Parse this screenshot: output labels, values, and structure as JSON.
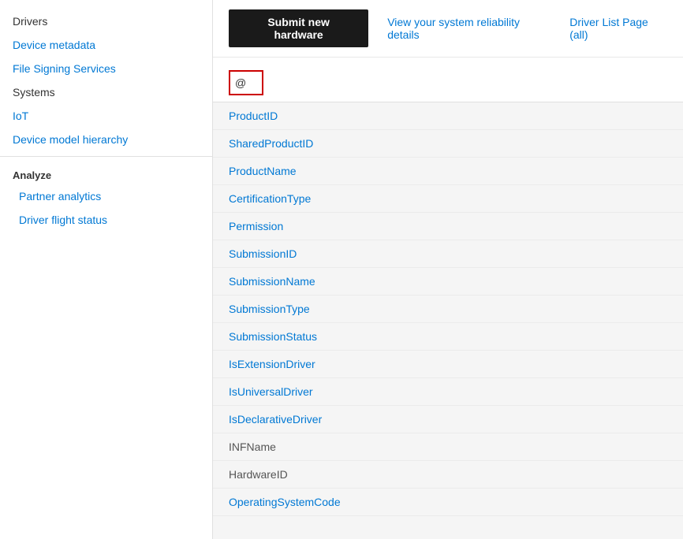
{
  "sidebar": {
    "items": [
      {
        "id": "drivers",
        "label": "Drivers",
        "style": "plain",
        "clickable": true
      },
      {
        "id": "device-metadata",
        "label": "Device metadata",
        "style": "link",
        "clickable": true
      },
      {
        "id": "file-signing-services",
        "label": "File Signing Services",
        "style": "link",
        "clickable": true
      },
      {
        "id": "systems",
        "label": "Systems",
        "style": "plain",
        "clickable": true
      },
      {
        "id": "iot",
        "label": "IoT",
        "style": "link",
        "clickable": true
      },
      {
        "id": "device-model-hierarchy",
        "label": "Device model hierarchy",
        "style": "link",
        "clickable": true
      }
    ],
    "analyze_label": "Analyze",
    "analyze_items": [
      {
        "id": "partner-analytics",
        "label": "Partner analytics",
        "style": "link",
        "clickable": true
      },
      {
        "id": "driver-flight-status",
        "label": "Driver flight status",
        "style": "link",
        "clickable": true
      }
    ]
  },
  "topbar": {
    "submit_label": "Submit new hardware",
    "reliability_label": "View your system reliability details",
    "driver_list_label": "Driver List Page (all)"
  },
  "filter": {
    "symbol": "@"
  },
  "list": {
    "items": [
      {
        "id": "productid",
        "label": "ProductID",
        "style": "link"
      },
      {
        "id": "sharedproductid",
        "label": "SharedProductID",
        "style": "link"
      },
      {
        "id": "productname",
        "label": "ProductName",
        "style": "link"
      },
      {
        "id": "certificationtype",
        "label": "CertificationType",
        "style": "link"
      },
      {
        "id": "permission",
        "label": "Permission",
        "style": "link"
      },
      {
        "id": "submissionid",
        "label": "SubmissionID",
        "style": "link"
      },
      {
        "id": "submissionname",
        "label": "SubmissionName",
        "style": "link"
      },
      {
        "id": "submissiontype",
        "label": "SubmissionType",
        "style": "link"
      },
      {
        "id": "submissionstatus",
        "label": "SubmissionStatus",
        "style": "link"
      },
      {
        "id": "isextensiondriver",
        "label": "IsExtensionDriver",
        "style": "link"
      },
      {
        "id": "isuniversaldriver",
        "label": "IsUniversalDriver",
        "style": "link"
      },
      {
        "id": "isdeclarativedriver",
        "label": "IsDeclarativeDriver",
        "style": "link"
      },
      {
        "id": "infname",
        "label": "INFName",
        "style": "gray"
      },
      {
        "id": "hardwareid",
        "label": "HardwareID",
        "style": "gray"
      },
      {
        "id": "operatingsystemcode",
        "label": "OperatingSystemCode",
        "style": "link"
      }
    ]
  }
}
